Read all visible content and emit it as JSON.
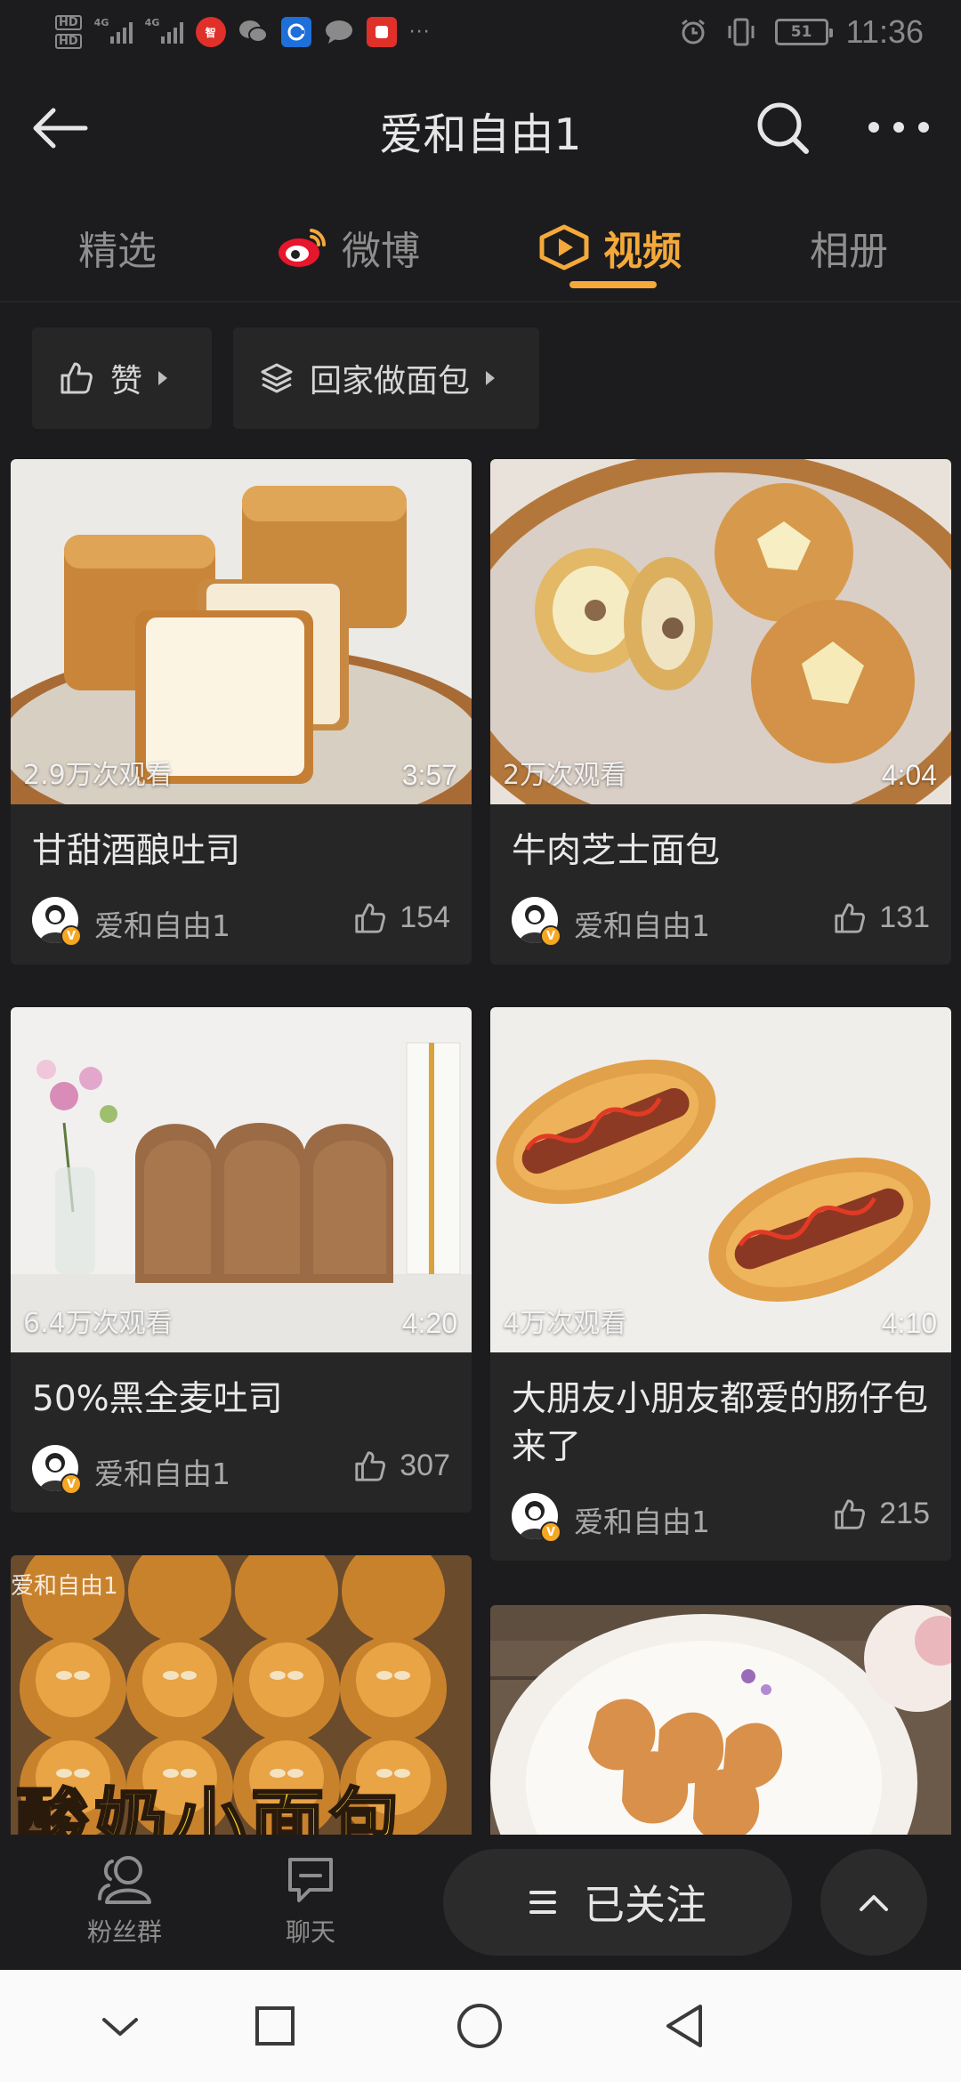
{
  "status_bar": {
    "time": "11:36",
    "battery": "51",
    "hd_labels": [
      "HD",
      "HD"
    ],
    "network_labels": [
      "4G",
      "4G"
    ],
    "notification_apps": [
      {
        "name": "news-app",
        "text": "智",
        "color": "#e0302a"
      },
      {
        "name": "wechat-app",
        "text": "",
        "color": "#8a8a8a"
      },
      {
        "name": "bank-app",
        "text": "",
        "color": "#1e6fd9"
      },
      {
        "name": "message-app",
        "text": "",
        "color": "#8a8a8a"
      },
      {
        "name": "shop-app",
        "text": "",
        "color": "#e0302a"
      }
    ]
  },
  "header": {
    "title": "爱和自由1"
  },
  "tabs": [
    {
      "label": "精选",
      "active": false
    },
    {
      "label": "微博",
      "active": false,
      "icon": "weibo-icon"
    },
    {
      "label": "视频",
      "active": true,
      "icon": "video-icon"
    },
    {
      "label": "相册",
      "active": false
    }
  ],
  "filters": {
    "like_label": "赞",
    "collection_label": "回家做面包"
  },
  "videos": [
    {
      "title": "甘甜酒酿吐司",
      "views": "2.9万次观看",
      "duration": "3:57",
      "author": "爱和自由1",
      "likes": "154"
    },
    {
      "title": "牛肉芝士面包",
      "views": "2万次观看",
      "duration": "4:04",
      "author": "爱和自由1",
      "likes": "131"
    },
    {
      "title": "50%黑全麦吐司",
      "views": "6.4万次观看",
      "duration": "4:20",
      "author": "爱和自由1",
      "likes": "307"
    },
    {
      "title": "大朋友小朋友都爱的肠仔包来了",
      "views": "4万次观看",
      "duration": "4:10",
      "author": "爱和自由1",
      "likes": "215"
    },
    {
      "title": "",
      "watermark": "爱和自由1",
      "overlay_text": "酸奶小面包"
    },
    {
      "title": ""
    }
  ],
  "action_bar": {
    "fans_group_label": "粉丝群",
    "chat_label": "聊天",
    "follow_label": "已关注"
  },
  "colors": {
    "accent": "#f4a93a",
    "background": "#1c1c1e",
    "card": "#262626",
    "weibo_red": "#e6162d"
  }
}
